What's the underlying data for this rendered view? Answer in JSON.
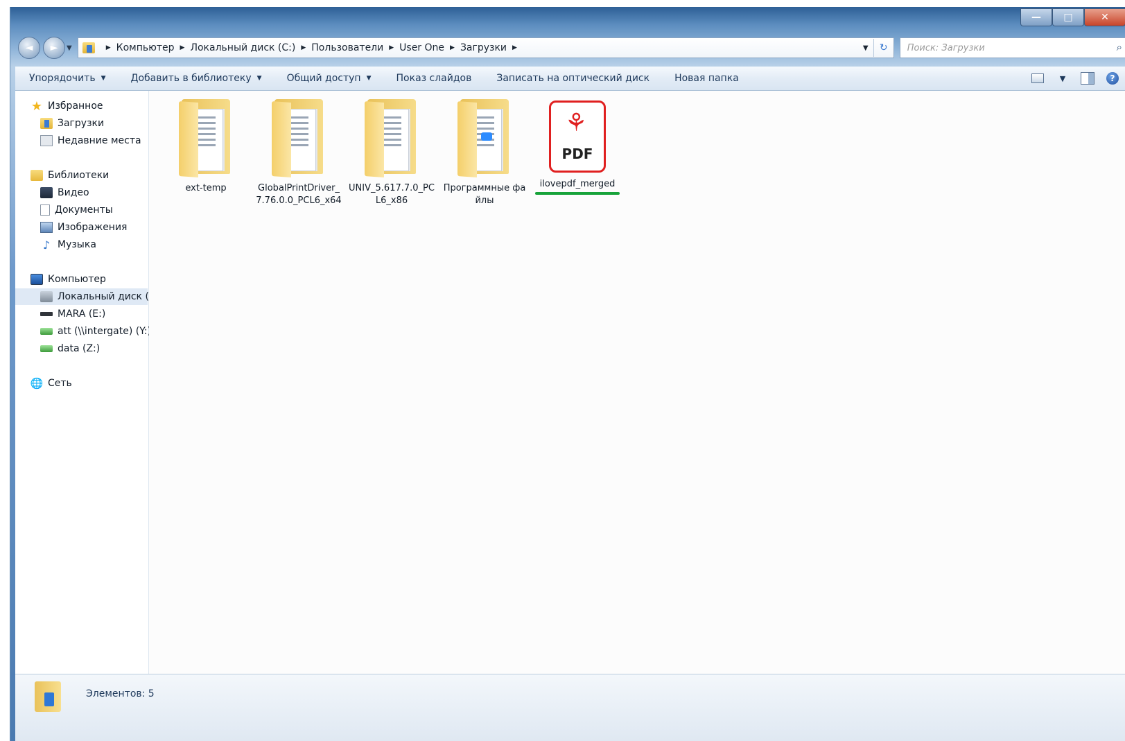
{
  "window": {
    "caption_buttons": [
      "—",
      "□",
      "✕"
    ]
  },
  "navigation": {
    "back_icon": "back-arrow-icon",
    "forward_icon": "forward-arrow-icon",
    "breadcrumbs": [
      "Компьютер",
      "Локальный диск (C:)",
      "Пользователи",
      "User One",
      "Загрузки"
    ],
    "search_placeholder": "Поиск: Загрузки"
  },
  "toolbar": {
    "organize": "Упорядочить",
    "add_to_library": "Добавить в библиотеку",
    "share": "Общий доступ",
    "slideshow": "Показ слайдов",
    "burn": "Записать на оптический диск",
    "new_folder": "Новая папка"
  },
  "sidebar": {
    "favorites": {
      "label": "Избранное",
      "items": [
        "Загрузки",
        "Недавние места"
      ]
    },
    "libraries": {
      "label": "Библиотеки",
      "items": [
        "Видео",
        "Документы",
        "Изображения",
        "Музыка"
      ]
    },
    "computer": {
      "label": "Компьютер",
      "items": [
        "Локальный диск (C",
        "MARA (E:)",
        "att (\\\\intergate) (Y:)",
        "data (Z:)"
      ]
    },
    "network": {
      "label": "Сеть"
    }
  },
  "files": [
    {
      "name": "ext-temp",
      "type": "folder"
    },
    {
      "name": "GlobalPrintDriver_7.76.0.0_PCL6_x64",
      "type": "folder"
    },
    {
      "name": "UNIV_5.617.7.0_PCL6_x86",
      "type": "folder"
    },
    {
      "name": "Программные файлы",
      "type": "folder"
    },
    {
      "name": "ilovepdf_merged",
      "type": "pdf",
      "icon_label": "PDF",
      "highlight_color": "#17a33a"
    }
  ],
  "status": {
    "items_count": "Элементов: 5"
  },
  "colors": {
    "pdf_red": "#e02020",
    "highlight_green": "#17a33a",
    "toolbar_text": "#1e395b"
  }
}
